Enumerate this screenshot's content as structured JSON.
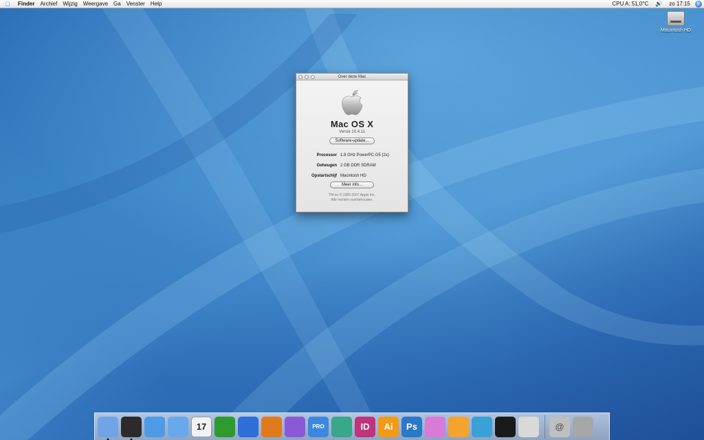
{
  "menubar": {
    "apple_icon": "apple-icon",
    "items": [
      "Finder",
      "Archief",
      "Wijzig",
      "Weergave",
      "Ga",
      "Venster",
      "Help"
    ],
    "cpu": "CPU A: 51,0°C",
    "volume_icon": "speaker-icon",
    "clock": "zo 17:15",
    "spotlight_icon": "spotlight-icon"
  },
  "desktop": {
    "hd_label": "Macintosh HD"
  },
  "about": {
    "window_title": "Over deze Mac",
    "os_name": "Mac OS X",
    "version": "Versie 10.4.11",
    "update_button": "Software-update...",
    "specs": [
      {
        "label": "Processor",
        "value": "1.8 GHz PowerPC G5 (2x)"
      },
      {
        "label": "Geheugen",
        "value": "2 GB DDR SDRAM"
      },
      {
        "label": "Opstartschijf",
        "value": "Macintosh HD"
      }
    ],
    "more_button": "Meer info...",
    "copyright_1": "TM en © 1983-2007 Apple Inc.",
    "copyright_2": "Alle rechten voorbehouden."
  },
  "dock": {
    "apps": [
      {
        "name": "finder-icon",
        "text": "",
        "color": "#6fa4e6"
      },
      {
        "name": "dashboard-icon",
        "text": "",
        "color": "#2b2b2b"
      },
      {
        "name": "safari-icon",
        "text": "",
        "color": "#4f9ae6"
      },
      {
        "name": "itunes-icon",
        "text": "",
        "color": "#67a9ea"
      },
      {
        "name": "ical-icon",
        "text": "17",
        "color": "#f2f2f2"
      },
      {
        "name": "excel-icon",
        "text": "",
        "color": "#2e9b2e"
      },
      {
        "name": "word-icon",
        "text": "",
        "color": "#2d6fd6"
      },
      {
        "name": "powerpoint-icon",
        "text": "",
        "color": "#e07a1c"
      },
      {
        "name": "entourage-icon",
        "text": "",
        "color": "#8a5ad6"
      },
      {
        "name": "quicktime-pro-icon",
        "text": "PRO",
        "color": "#3c88dd"
      },
      {
        "name": "network-icon",
        "text": "",
        "color": "#37a88a"
      },
      {
        "name": "indesign-icon",
        "text": "ID",
        "color": "#c0347e"
      },
      {
        "name": "illustrator-icon",
        "text": "Ai",
        "color": "#f39a16"
      },
      {
        "name": "photoshop-icon",
        "text": "Ps",
        "color": "#2a78c8"
      },
      {
        "name": "butterfly-icon",
        "text": "",
        "color": "#d77ad8"
      },
      {
        "name": "flower-icon",
        "text": "",
        "color": "#f4a32c"
      },
      {
        "name": "feather-icon",
        "text": "",
        "color": "#3aa0d8"
      },
      {
        "name": "preview-eye-icon",
        "text": "",
        "color": "#1a1a1a"
      },
      {
        "name": "apple-info-icon",
        "text": "",
        "color": "#d9d9d9"
      },
      {
        "name": "mail-icon",
        "text": "@",
        "color": "#bfbfbf"
      },
      {
        "name": "trash-icon",
        "text": "",
        "color": "#a7a7a7"
      }
    ]
  }
}
